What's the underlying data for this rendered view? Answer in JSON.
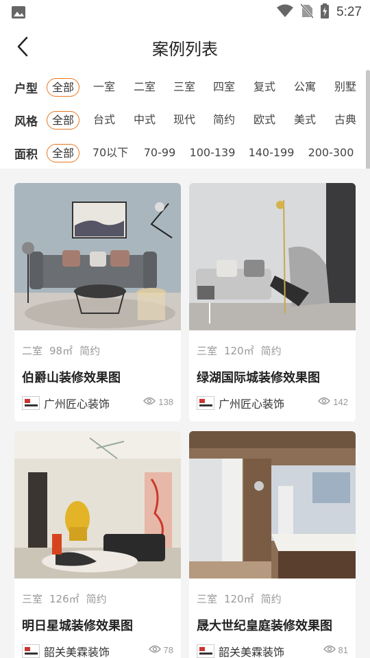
{
  "status_bar": {
    "time": "5:27"
  },
  "header": {
    "title": "案例列表"
  },
  "filters": [
    {
      "label": "户型",
      "options": [
        "全部",
        "一室",
        "二室",
        "三室",
        "四室",
        "复式",
        "公寓",
        "别墅"
      ],
      "selected": "全部"
    },
    {
      "label": "风格",
      "options": [
        "全部",
        "台式",
        "中式",
        "现代",
        "简约",
        "欧式",
        "美式",
        "古典"
      ],
      "selected": "全部"
    },
    {
      "label": "面积",
      "options": [
        "全部",
        "70以下",
        "70-99",
        "100-139",
        "140-199",
        "200-300"
      ],
      "selected": "全部"
    }
  ],
  "cases": [
    {
      "rooms": "二室",
      "area": "98㎡",
      "style": "简约",
      "title": "伯爵山装修效果图",
      "company": "广州匠心装饰",
      "views": "138"
    },
    {
      "rooms": "三室",
      "area": "120㎡",
      "style": "简约",
      "title": "绿湖国际城装修效果图",
      "company": "广州匠心装饰",
      "views": "142"
    },
    {
      "rooms": "三室",
      "area": "126㎡",
      "style": "简约",
      "title": "明日星城装修效果图",
      "company": "韶关美霖装饰",
      "views": "78"
    },
    {
      "rooms": "三室",
      "area": "120㎡",
      "style": "简约",
      "title": "晟大世纪皇庭装修效果图",
      "company": "韶关美霖装饰",
      "views": "81"
    }
  ],
  "colors": {
    "accent": "#e8741e",
    "background": "#f4f4f4"
  },
  "icons": {
    "back": "chevron-left-icon",
    "views": "eye-icon",
    "status": [
      "image-icon",
      "wifi-icon",
      "no-sim-icon",
      "battery-charging-icon"
    ]
  }
}
